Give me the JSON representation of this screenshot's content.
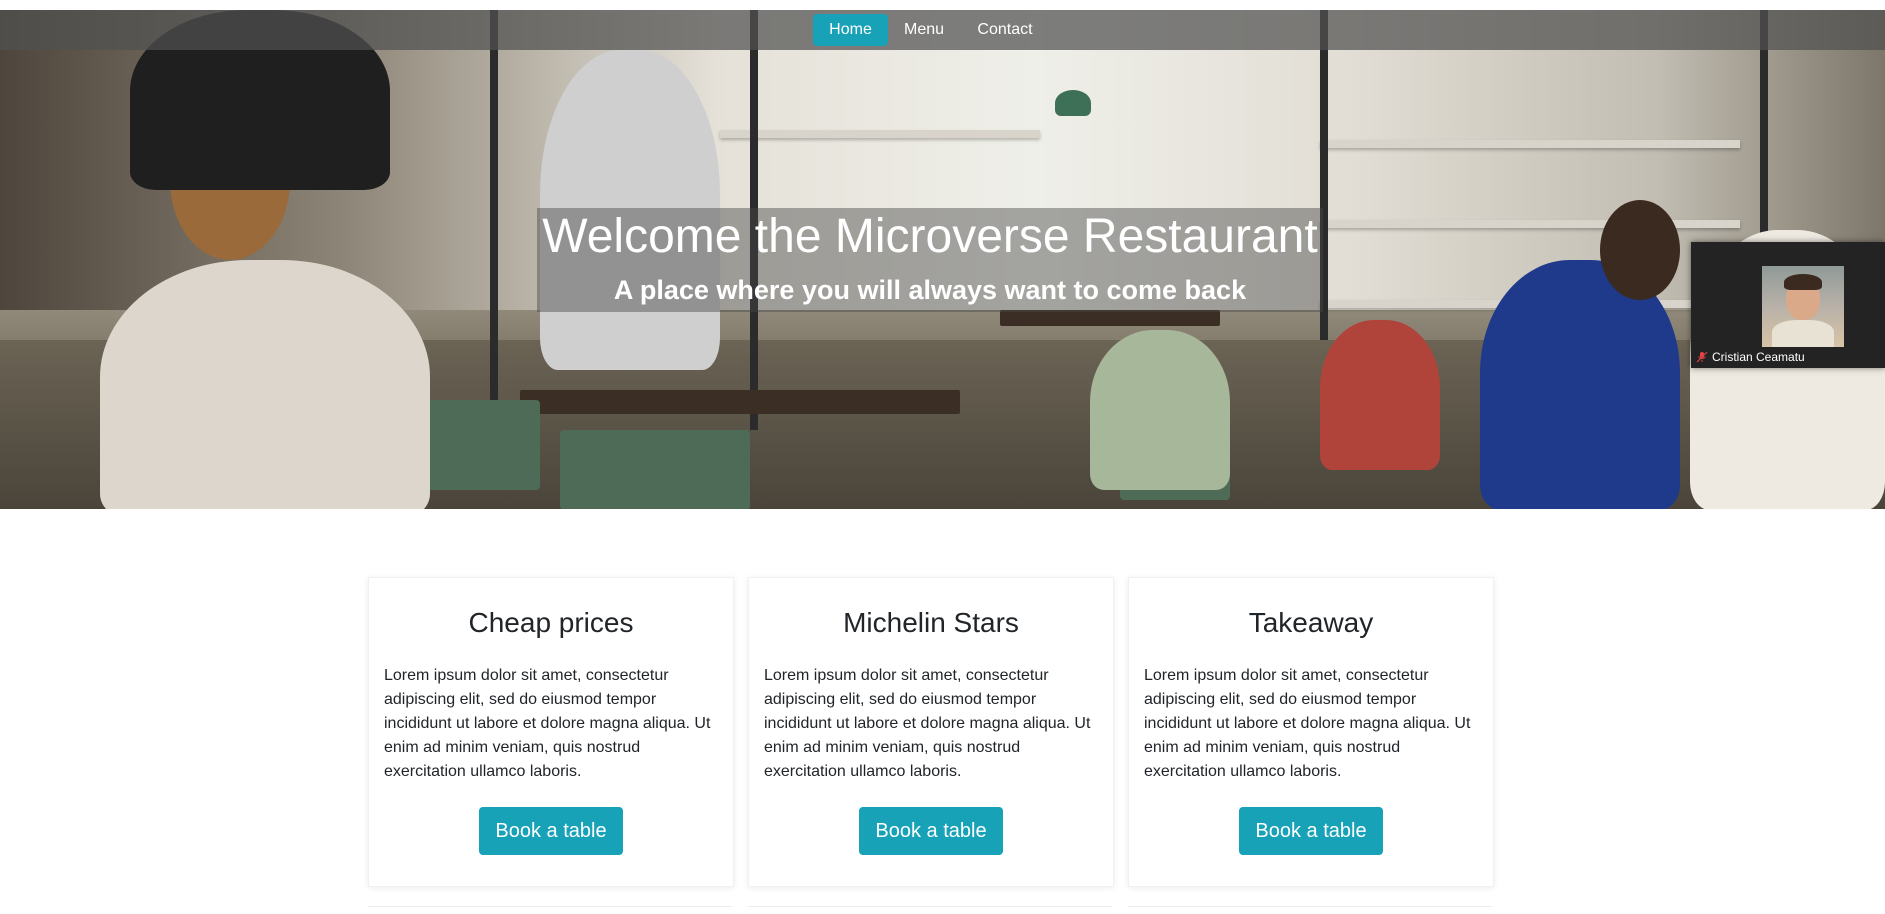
{
  "nav": {
    "items": [
      {
        "label": "Home",
        "active": true
      },
      {
        "label": "Menu",
        "active": false
      },
      {
        "label": "Contact",
        "active": false
      }
    ]
  },
  "hero": {
    "title": "Welcome the Microverse Restaurant",
    "subtitle": "A place where you will always want to come back"
  },
  "video": {
    "participant_name": "Cristian Ceamatu",
    "mic_icon": "mic-off-icon"
  },
  "cards": [
    {
      "title": "Cheap prices",
      "text": "Lorem ipsum dolor sit amet, consectetur adipiscing elit, sed do eiusmod tempor incididunt ut labore et dolore magna aliqua. Ut enim ad minim veniam, quis nostrud exercitation ullamco laboris.",
      "button_label": "Book a table"
    },
    {
      "title": "Michelin Stars",
      "text": "Lorem ipsum dolor sit amet, consectetur adipiscing elit, sed do eiusmod tempor incididunt ut labore et dolore magna aliqua. Ut enim ad minim veniam, quis nostrud exercitation ullamco laboris.",
      "button_label": "Book a table"
    },
    {
      "title": "Takeaway",
      "text": "Lorem ipsum dolor sit amet, consectetur adipiscing elit, sed do eiusmod tempor incididunt ut labore et dolore magna aliqua. Ut enim ad minim veniam, quis nostrud exercitation ullamco laboris.",
      "button_label": "Book a table"
    }
  ],
  "colors": {
    "accent": "#17a2b8",
    "text": "#212529",
    "navbar_overlay": "rgba(80,80,80,0.72)"
  }
}
